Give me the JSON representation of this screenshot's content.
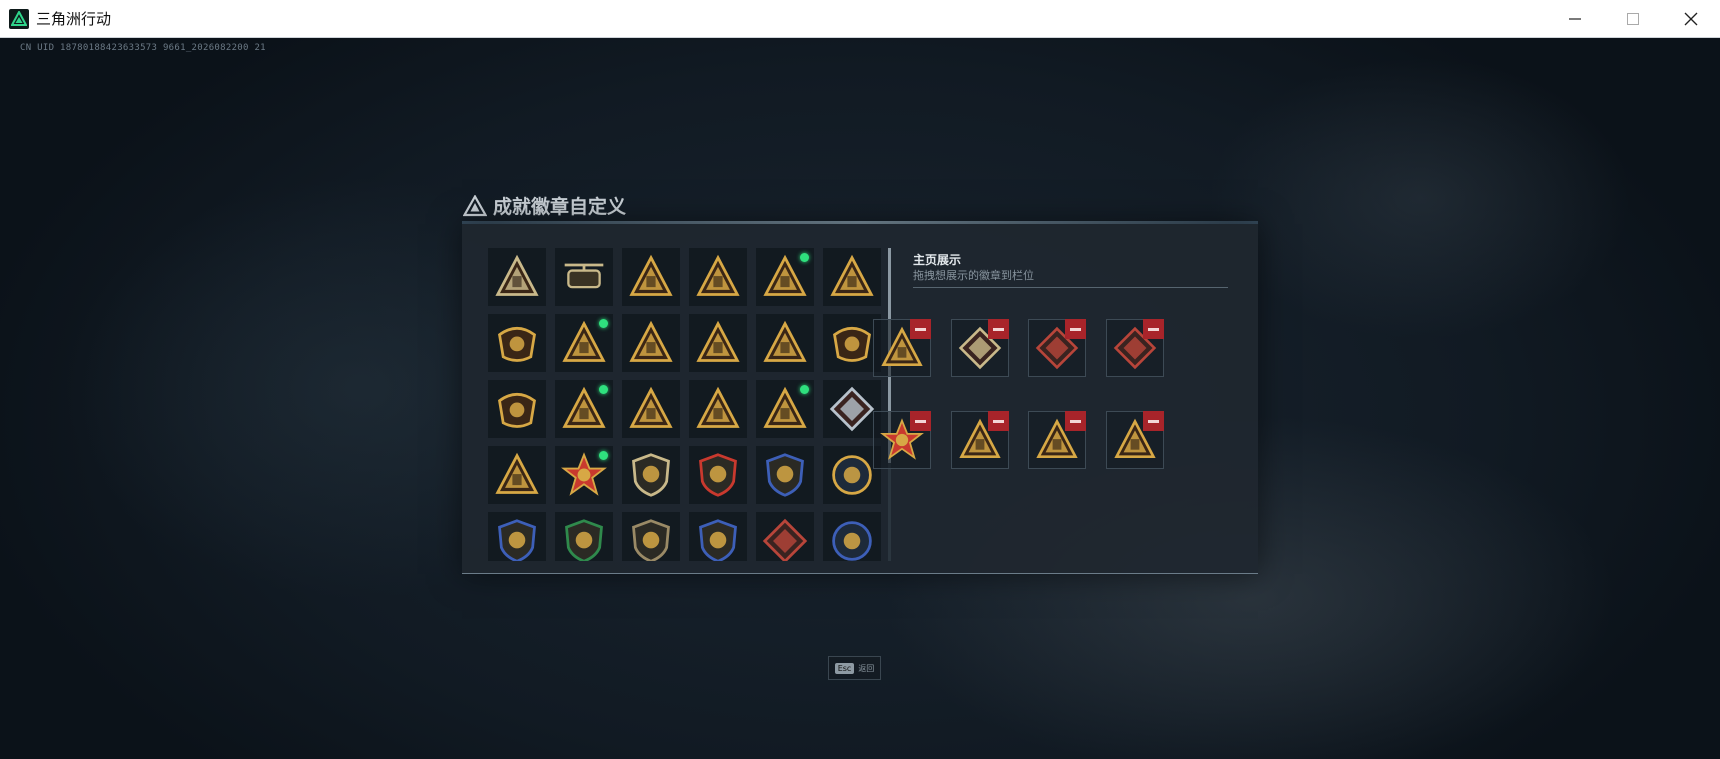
{
  "window": {
    "title": "三角洲行动",
    "app_icon": "delta-logo-icon",
    "controls": [
      "minimize-icon",
      "maximize-icon",
      "close-icon"
    ]
  },
  "uid_text": "CN UID 18780188423633573 9661_2026082200 21",
  "panel": {
    "title": "成就徽章自定义",
    "title_icon": "delta-triangle-icon"
  },
  "badges": [
    {
      "icon": "shield-triangle-badge-icon",
      "color": "#c9b98a",
      "new": false
    },
    {
      "icon": "helicopter-badge-icon",
      "color": "#c9b98a",
      "new": false
    },
    {
      "icon": "triangle-armor-badge-icon",
      "color": "#d7a845",
      "new": false
    },
    {
      "icon": "triangle-vault-badge-icon",
      "color": "#d7a845",
      "new": false
    },
    {
      "icon": "triangle-sd-card-badge-icon",
      "color": "#d7a845",
      "new": true
    },
    {
      "icon": "triangle-tower-badge-icon",
      "color": "#d7a845",
      "new": false
    },
    {
      "icon": "winged-skull-badge-icon",
      "color": "#d7a845",
      "new": false
    },
    {
      "icon": "triangle-soldier-badge-icon",
      "color": "#d7a845",
      "new": true
    },
    {
      "icon": "crossed-swords-triangle-badge-icon",
      "color": "#d7a845",
      "new": false
    },
    {
      "icon": "triangle-helmet-badge-icon",
      "color": "#d7a845",
      "new": false
    },
    {
      "icon": "triangle-number-one-badge-icon",
      "color": "#d7a845",
      "new": false
    },
    {
      "icon": "wreath-emblem-badge-icon",
      "color": "#d7a845",
      "new": false
    },
    {
      "icon": "gear-emblem-badge-icon",
      "color": "#d7a845",
      "new": false
    },
    {
      "icon": "triangle-crate-badge-icon",
      "color": "#d7a845",
      "new": true
    },
    {
      "icon": "triangle-flag-badge-icon",
      "color": "#d7a845",
      "new": false
    },
    {
      "icon": "triangle-squad-badge-icon",
      "color": "#d7a845",
      "new": false
    },
    {
      "icon": "triangle-rocket-badge-icon",
      "color": "#d7a845",
      "new": true
    },
    {
      "icon": "crystal-diamond-badge-icon",
      "color": "#b7c2cc",
      "new": false
    },
    {
      "icon": "triangle-gear-badge-icon",
      "color": "#d7a845",
      "new": false
    },
    {
      "icon": "star-medal-badge-icon",
      "color": "#c9392e",
      "new": true
    },
    {
      "icon": "shield-rank-badge-icon",
      "color": "#c9b98a",
      "new": false
    },
    {
      "icon": "red-shield-stars-badge-icon",
      "color": "#c9392e",
      "new": false
    },
    {
      "icon": "blue-shield-eagle-badge-icon",
      "color": "#3d5fb8",
      "new": false
    },
    {
      "icon": "round-skull-badge-icon",
      "color": "#d7a845",
      "new": false
    },
    {
      "icon": "blue-shield-wings-badge-icon",
      "color": "#3d5fb8",
      "new": false
    },
    {
      "icon": "green-shield-badge-icon",
      "color": "#2f8a4c",
      "new": false
    },
    {
      "icon": "dark-shield-crosshair-badge-icon",
      "color": "#9a8a66",
      "new": false
    },
    {
      "icon": "blue-shield-rifles-badge-icon",
      "color": "#3d5fb8",
      "new": false
    },
    {
      "icon": "red-diamond-beast-badge-icon",
      "color": "#b8453a",
      "new": false
    },
    {
      "icon": "blue-circle-eagle-badge-icon",
      "color": "#3d5fb8",
      "new": false
    }
  ],
  "showcase": {
    "title": "主页展示",
    "subtitle": "拖拽想展示的徽章到栏位",
    "remove_icon": "minus-icon",
    "slots": [
      {
        "icon": "triangle-crate-badge-icon",
        "color": "#d7a845"
      },
      {
        "icon": "diamond-beast-badge-icon",
        "color": "#c9b98a"
      },
      {
        "icon": "diamond-dragon-badge-icon",
        "color": "#b8453a"
      },
      {
        "icon": "diamond-dragon-red-badge-icon",
        "color": "#b8453a"
      },
      {
        "icon": "star-medal-badge-icon",
        "color": "#c9392e"
      },
      {
        "icon": "triangle-sd-card-badge-icon",
        "color": "#d7a845"
      },
      {
        "icon": "triangle-rocket-badge-icon",
        "color": "#d7a845"
      },
      {
        "icon": "triangle-soldier-badge-icon",
        "color": "#d7a845"
      }
    ]
  },
  "footer": {
    "esc_key": "Esc",
    "back_label": "返回"
  }
}
